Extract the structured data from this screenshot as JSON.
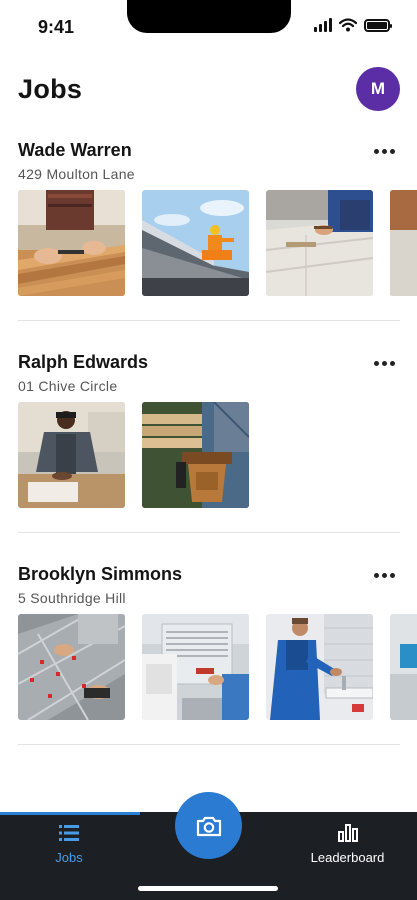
{
  "status_bar": {
    "time": "9:41"
  },
  "header": {
    "title": "Jobs",
    "avatar_initial": "M"
  },
  "jobs": [
    {
      "name": "Wade Warren",
      "address": "429 Moulton Lane",
      "photos": [
        "carpentry-wood-cutting",
        "roof-worker-orange",
        "floor-installation",
        "partial-wood"
      ]
    },
    {
      "name": "Ralph Edwards",
      "address": "01 Chive Circle",
      "photos": [
        "workshop-carpenter",
        "tool-belt-lumber"
      ]
    },
    {
      "name": "Brooklyn Simmons",
      "address": "5 Southridge Hill",
      "photos": [
        "tile-laying",
        "hvac-unit-repair",
        "plumber-sink",
        "partial-blue-worker"
      ]
    }
  ],
  "bottom_nav": {
    "jobs_label": "Jobs",
    "leaderboard_label": "Leaderboard",
    "active_tab": "Jobs"
  },
  "colors": {
    "accent": "#2a7bd1",
    "avatar": "#5b2ea6",
    "nav_background": "#1c1f24",
    "nav_active": "#4a9be6"
  }
}
